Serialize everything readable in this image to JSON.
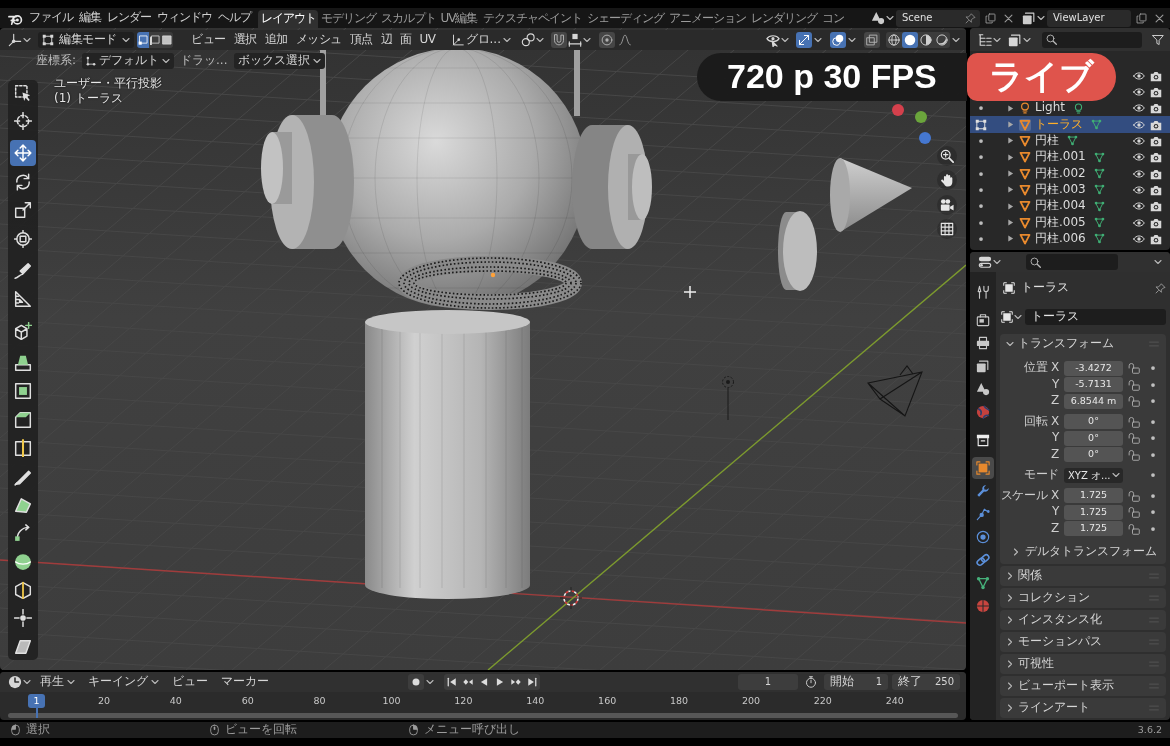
{
  "top_bar": {
    "menus": [
      "ファイル",
      "編集",
      "レンダー",
      "ウィンドウ",
      "ヘルプ"
    ],
    "workspaces": [
      {
        "label": "レイアウト",
        "selected": true
      },
      {
        "label": "モデリング",
        "selected": false
      },
      {
        "label": "スカルプト",
        "selected": false
      },
      {
        "label": "UV編集",
        "selected": false
      },
      {
        "label": "テクスチャペイント",
        "selected": false
      },
      {
        "label": "シェーディング",
        "selected": false
      },
      {
        "label": "アニメーション",
        "selected": false
      },
      {
        "label": "レンダリング",
        "selected": false
      },
      {
        "label": "コン",
        "selected": false
      }
    ],
    "scene": "Scene",
    "view_layer": "ViewLayer"
  },
  "viewport": {
    "header": {
      "mode": "編集モード",
      "select_modes": [
        {
          "selected": true
        },
        {
          "selected": false
        },
        {
          "selected": false
        }
      ],
      "menus": [
        "ビュー",
        "選択",
        "追加",
        "メッシュ",
        "頂点",
        "辺",
        "面",
        "UV"
      ],
      "orientation": "グロ...",
      "snap": {
        "on": false
      },
      "proportional_editing": {
        "on": false
      },
      "gizmos": {
        "on": true
      },
      "overlays": {
        "on": true
      },
      "xray": {
        "on": false
      },
      "shading_modes": [
        {
          "selected": false
        },
        {
          "selected": true
        },
        {
          "selected": false
        },
        {
          "selected": false
        }
      ]
    },
    "tool_settings": {
      "label": "座標系:",
      "orientation": "デフォルト",
      "drag_label": "ドラッ...",
      "drag_tool": "ボックス選択"
    },
    "overlay_text": [
      "ユーザー・平行投影",
      "(1) トーラス"
    ],
    "toolbar": {
      "groups": [
        {
          "tools": [
            {
              "selected": false
            },
            {
              "selected": false
            }
          ]
        },
        {
          "tools": [
            {
              "selected": true
            },
            {
              "selected": false
            },
            {
              "selected": false
            },
            {
              "selected": false
            }
          ]
        },
        {
          "tools": [
            {
              "selected": false
            },
            {
              "selected": false
            }
          ]
        },
        {
          "tools": [
            {
              "selected": false
            }
          ]
        },
        {
          "tools": [
            {
              "selected": false
            },
            {
              "selected": false
            },
            {
              "selected": false
            },
            {
              "selected": false
            },
            {
              "selected": false
            },
            {
              "selected": false
            },
            {
              "selected": false
            },
            {
              "selected": false
            },
            {
              "selected": false
            },
            {
              "selected": false
            },
            {
              "selected": false
            }
          ]
        }
      ]
    }
  },
  "stream_badge": {
    "quality": "720 p 30 FPS",
    "live": "ライブ"
  },
  "outliner": {
    "tree": [
      {
        "selected": false,
        "visible": true,
        "children": [
          {
            "selected": false,
            "visible": true
          },
          {
            "name": "Light",
            "kind": "light",
            "selected": false,
            "visible": true
          },
          {
            "name": "トーラス",
            "kind": "mesh",
            "selected": true,
            "visible": true
          },
          {
            "name": "円柱",
            "kind": "mesh",
            "selected": false,
            "visible": true
          },
          {
            "name": "円柱.001",
            "kind": "mesh",
            "selected": false,
            "visible": true
          },
          {
            "name": "円柱.002",
            "kind": "mesh",
            "selected": false,
            "visible": true
          },
          {
            "name": "円柱.003",
            "kind": "mesh",
            "selected": false,
            "visible": true
          },
          {
            "name": "円柱.004",
            "kind": "mesh",
            "selected": false,
            "visible": true
          },
          {
            "name": "円柱.005",
            "kind": "mesh",
            "selected": false,
            "visible": true
          },
          {
            "name": "円柱.006",
            "kind": "mesh",
            "selected": false,
            "visible": true
          }
        ]
      }
    ]
  },
  "properties": {
    "tab_groups": [
      {
        "tabs": [
          {
            "selected": false
          }
        ]
      },
      {
        "tabs": [
          {
            "selected": false
          },
          {
            "selected": false
          },
          {
            "selected": false
          },
          {
            "selected": false
          },
          {
            "selected": false
          }
        ]
      },
      {
        "tabs": [
          {
            "selected": false
          }
        ]
      },
      {
        "tabs": [
          {
            "selected": true
          },
          {
            "selected": false
          },
          {
            "selected": false
          },
          {
            "selected": false
          },
          {
            "selected": false
          },
          {
            "selected": false
          },
          {
            "selected": false
          }
        ]
      }
    ],
    "context": "トーラス",
    "object_name": "トーラス",
    "panels": [
      {
        "title": "トランスフォーム",
        "expanded": true,
        "field_groups": [
          {
            "rows": [
              {
                "label": "位置 X",
                "value": "-3.4272",
                "kind": "number"
              },
              {
                "label": "Y",
                "value": "-5.7131",
                "kind": "number"
              },
              {
                "label": "Z",
                "value": "6.8544 m",
                "kind": "number"
              }
            ]
          },
          {
            "rows": [
              {
                "label": "回転 X",
                "value": "0°",
                "kind": "number"
              },
              {
                "label": "Y",
                "value": "0°",
                "kind": "number"
              },
              {
                "label": "Z",
                "value": "0°",
                "kind": "number"
              }
            ]
          },
          {
            "rows": [
              {
                "label": "モード",
                "value": "XYZ オ...",
                "kind": "dropdown"
              }
            ]
          },
          {
            "rows": [
              {
                "label": "スケール X",
                "value": "1.725",
                "kind": "number"
              },
              {
                "label": "Y",
                "value": "1.725",
                "kind": "number"
              },
              {
                "label": "Z",
                "value": "1.725",
                "kind": "number"
              }
            ]
          }
        ],
        "subpanels": [
          {
            "title": "デルタトランスフォーム",
            "expanded": false
          }
        ]
      },
      {
        "title": "関係",
        "expanded": false
      },
      {
        "title": "コレクション",
        "expanded": false
      },
      {
        "title": "インスタンス化",
        "expanded": false
      },
      {
        "title": "モーションパス",
        "expanded": false
      },
      {
        "title": "可視性",
        "expanded": false
      },
      {
        "title": "ビューポート表示",
        "expanded": false
      },
      {
        "title": "ラインアート",
        "expanded": false
      }
    ]
  },
  "timeline": {
    "menus": [
      {
        "label": "再生",
        "kind": "dropdown"
      },
      {
        "label": "キーイング",
        "kind": "dropdown"
      },
      {
        "label": "ビュー",
        "kind": "menu"
      },
      {
        "label": "マーカー",
        "kind": "menu"
      }
    ],
    "current_frame": "1",
    "start": {
      "label": "開始",
      "value": "1"
    },
    "end": {
      "label": "終了",
      "value": "250"
    },
    "ruler": {
      "playhead": "1",
      "labels": [
        "20",
        "40",
        "60",
        "80",
        "100",
        "120",
        "140",
        "160",
        "180",
        "200",
        "220",
        "240"
      ]
    }
  },
  "status_bar": {
    "hints": [
      {
        "text": "選択"
      },
      {
        "text": "ビューを回転"
      },
      {
        "text": "メニュー呼び出し"
      }
    ],
    "version": "3.6.2"
  }
}
